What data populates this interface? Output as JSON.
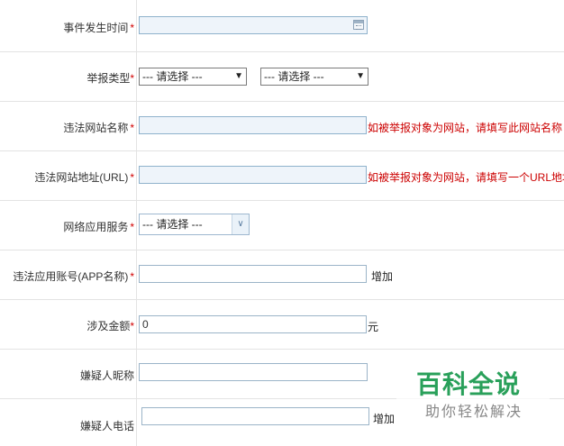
{
  "form": {
    "time": {
      "label": "事件发生时间",
      "required": "*",
      "value": ""
    },
    "report_type": {
      "label": "举报类型",
      "required": "*",
      "select1": "--- 请选择 ---",
      "select2": "--- 请选择 ---"
    },
    "site_name": {
      "label": "违法网站名称",
      "required": "*",
      "value": "",
      "hint": "如被举报对象为网站，请填写此网站名称"
    },
    "site_url": {
      "label": "违法网站地址(URL)",
      "required": "*",
      "value": "",
      "hint": "如被举报对象为网站，请填写一个URL地址"
    },
    "service": {
      "label": "网络应用服务",
      "required": "*",
      "select": "--- 请选择 ---"
    },
    "account": {
      "label": "违法应用账号(APP名称)",
      "required": "*",
      "value": "",
      "add": "增加"
    },
    "amount": {
      "label": "涉及金额",
      "required": "*",
      "value": "0",
      "unit": "元"
    },
    "nickname": {
      "label": "嫌疑人昵称",
      "value": ""
    },
    "phone": {
      "label": "嫌疑人电话",
      "value": "",
      "add": "增加"
    }
  },
  "watermark": {
    "title": "百科全说",
    "subtitle": "助你轻松解决"
  },
  "icons": {
    "calendar": "calendar-icon",
    "dropdown": "chevron-down-icon"
  }
}
